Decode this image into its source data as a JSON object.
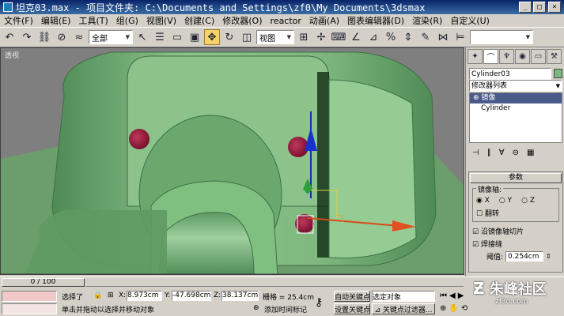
{
  "window": {
    "title": "坦克03.max   - 项目文件夹: C:\\Documents and Settings\\zf0\\My Documents\\3dsmax",
    "minimize": "_",
    "maximize": "□",
    "close": "×"
  },
  "menu": [
    "文件(F)",
    "编辑(E)",
    "工具(T)",
    "组(G)",
    "视图(V)",
    "创建(C)",
    "修改器(O)",
    "reactor",
    "动画(A)",
    "图表编辑器(D)",
    "渲染(R)",
    "自定义(U)"
  ],
  "toolbar": {
    "selection_filter": "全部",
    "reference_coord": "视图",
    "icons": [
      "undo-icon",
      "redo-icon",
      "link-icon",
      "unlink-icon",
      "bind-icon",
      "select-icon",
      "select-region-icon",
      "select-by-name-icon",
      "window-crossing-icon",
      "move-icon",
      "rotate-icon",
      "scale-icon"
    ]
  },
  "viewport": {
    "label": "透视",
    "colors": {
      "tank": "#7fb87f",
      "tank_dark": "#4f8a55",
      "dot": "#9a1a3a",
      "bg": "#7f7f7f"
    }
  },
  "command_panel": {
    "tabs": [
      "create-tab-icon",
      "modify-tab-icon",
      "hierarchy-tab-icon",
      "motion-tab-icon",
      "display-tab-icon",
      "utilities-tab-icon"
    ],
    "object_name": "Cylinder03",
    "modifier_list": "修改器列表",
    "stack": [
      "镜像",
      "Cylinder"
    ],
    "rollout_title": "参数",
    "mirror_axis_label": "镜像轴:",
    "axes": [
      "X",
      "Y",
      "Z"
    ],
    "flip_label": "翻转",
    "slice_label": "沿镜像轴切片",
    "weld_label": "焊接缝",
    "threshold_label": "阈值:",
    "threshold_value": "0.254cm"
  },
  "status": {
    "time_slider": "0 / 100",
    "selection": "选择了",
    "x_value": "8.973cm",
    "y_value": "-47.698cm",
    "z_value": "38.137cm",
    "grid": "栅格 = 25.4cm",
    "auto_key": "自动关键点",
    "set_key": "设置关键点",
    "selected_object": "选定对象",
    "key_filters": "关键点过滤器...",
    "prompt": "单击并拖动以选择并移动对象",
    "add_time_tag": "添加时间标记",
    "watermark": "朱峰社区",
    "watermark_url": "zf3d.com"
  }
}
